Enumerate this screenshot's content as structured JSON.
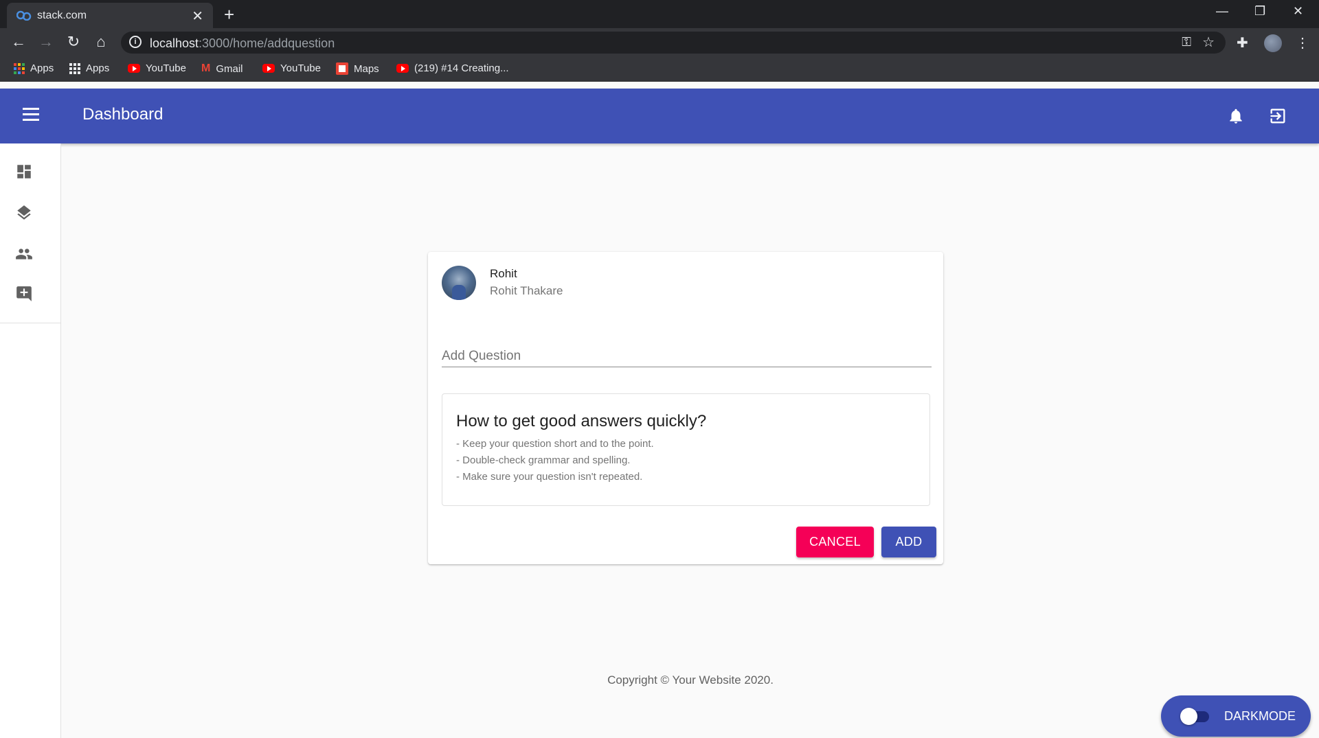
{
  "browser": {
    "tab_title": "stack.com",
    "close_glyph": "✕",
    "new_tab_glyph": "+",
    "url_host": "localhost",
    "url_path": ":3000/home/addquestion",
    "bookmarks": [
      {
        "label": "Apps",
        "icon": "apps-grid-color-icon"
      },
      {
        "label": "Apps",
        "icon": "apps-grid-icon"
      },
      {
        "label": "YouTube",
        "icon": "youtube-icon"
      },
      {
        "label": "Gmail",
        "icon": "gmail-icon"
      },
      {
        "label": "YouTube",
        "icon": "youtube-icon"
      },
      {
        "label": "Maps",
        "icon": "maps-icon"
      },
      {
        "label": "(219) #14 Creating...",
        "icon": "youtube-icon"
      }
    ]
  },
  "appbar": {
    "title": "Dashboard",
    "color": "#3f51b5"
  },
  "sidebar": {
    "items": [
      {
        "icon": "dashboard-icon"
      },
      {
        "icon": "layers-icon"
      },
      {
        "icon": "people-icon"
      },
      {
        "icon": "add-comment-icon"
      }
    ]
  },
  "card": {
    "username": "Rohit",
    "fullname": "Rohit Thakare",
    "question_placeholder": "Add Question",
    "question_value": "",
    "tips": {
      "heading": "How to get good answers quickly?",
      "lines": [
        "- Keep your question short and to the point.",
        "- Double-check grammar and spelling.",
        "- Make sure your question isn't repeated."
      ]
    },
    "cancel_label": "CANCEL",
    "add_label": "ADD",
    "cancel_color": "#f50057",
    "add_color": "#3f51b5"
  },
  "footer": {
    "text": "Copyright © Your Website 2020."
  },
  "darkmode": {
    "label": "DARKMODE",
    "enabled": false
  }
}
